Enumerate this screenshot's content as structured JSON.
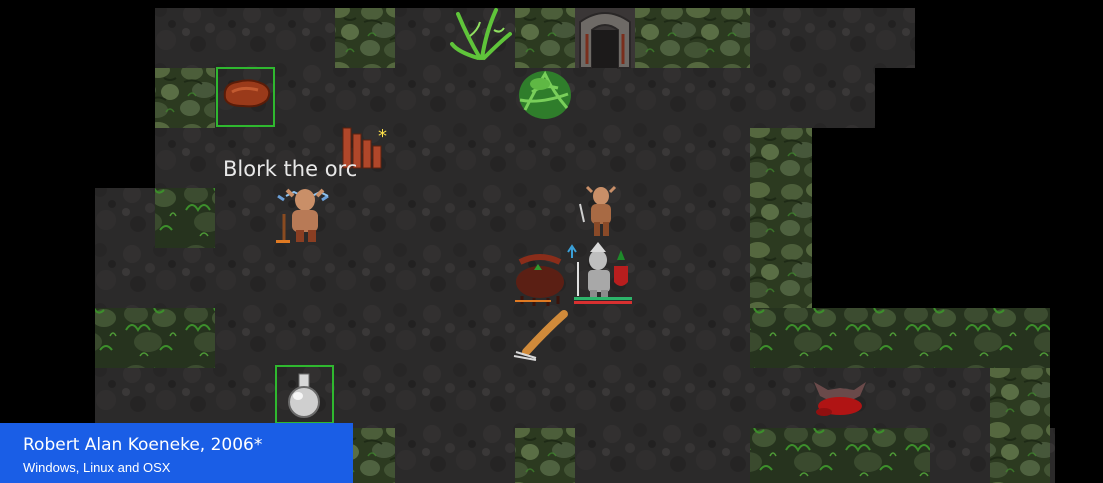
{
  "game": {
    "monster_label": "Blork the orc"
  },
  "caption": {
    "title": "Robert Alan Koeneke, 2006*",
    "subtitle": "Windows, Linux and OSX"
  },
  "colors": {
    "caption_bg": "#1a5ee6",
    "selection_outline": "#2fb82f",
    "player_health_bar": "#2db56b",
    "player_mana_bar": "#d83030"
  },
  "icons": {
    "monster_orc": "orc-icon",
    "player": "armored-knight-icon",
    "item_meat": "meat-ration-icon",
    "item_potion": "potion-flask-icon",
    "item_weapon": "club-weapon-icon",
    "item_rods": "wooden-rods-icon",
    "plant": "fern-plant-icon",
    "door": "stone-doorway-icon"
  }
}
